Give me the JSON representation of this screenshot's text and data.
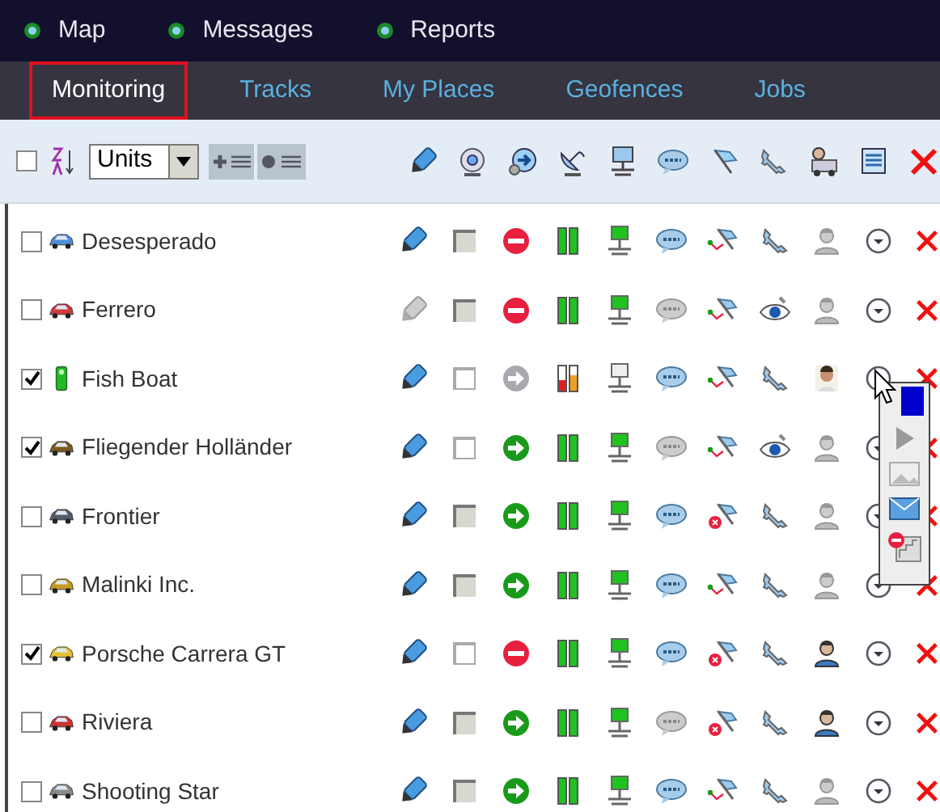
{
  "top_nav": [
    {
      "label": "Map"
    },
    {
      "label": "Messages"
    },
    {
      "label": "Reports"
    }
  ],
  "tabs": [
    {
      "label": "Monitoring",
      "selected": true
    },
    {
      "label": "Tracks",
      "selected": false
    },
    {
      "label": "My Places",
      "selected": false
    },
    {
      "label": "Geofences",
      "selected": false
    },
    {
      "label": "Jobs",
      "selected": false
    }
  ],
  "toolbar": {
    "select_all": false,
    "group_by": "Units"
  },
  "units": [
    {
      "name": "Desesperado",
      "checked": false,
      "kind": "car",
      "color": "#4f8fd8",
      "editable": true,
      "disabled": true,
      "stopped": true,
      "moving": false,
      "signal_low": false,
      "online": true,
      "sms": true,
      "route_error": false,
      "watched": false,
      "driver_assigned": false,
      "driver_photo": false
    },
    {
      "name": "Ferrero",
      "checked": false,
      "kind": "car",
      "color": "#d33a3a",
      "editable": false,
      "disabled": true,
      "stopped": true,
      "moving": false,
      "signal_low": false,
      "online": true,
      "sms": false,
      "route_error": false,
      "watched": true,
      "driver_assigned": false,
      "driver_photo": false
    },
    {
      "name": "Fish Boat",
      "checked": true,
      "kind": "traffic-light",
      "color": "#22bb22",
      "editable": true,
      "disabled": false,
      "stopped": false,
      "moving": false,
      "signal_low": true,
      "online": false,
      "sms": true,
      "route_error": false,
      "watched": false,
      "driver_assigned": true,
      "driver_photo": true
    },
    {
      "name": "Fliegender Holländer",
      "checked": true,
      "kind": "car",
      "color": "#7a5a20",
      "editable": true,
      "disabled": false,
      "stopped": false,
      "moving": true,
      "signal_low": false,
      "online": true,
      "sms": false,
      "route_error": false,
      "watched": true,
      "driver_assigned": false,
      "driver_photo": false
    },
    {
      "name": "Frontier",
      "checked": false,
      "kind": "car",
      "color": "#555a6a",
      "editable": true,
      "disabled": true,
      "stopped": false,
      "moving": true,
      "signal_low": false,
      "online": true,
      "sms": true,
      "route_error": true,
      "watched": false,
      "driver_assigned": false,
      "driver_photo": false
    },
    {
      "name": "Malinki Inc.",
      "checked": false,
      "kind": "car",
      "color": "#c89a20",
      "editable": true,
      "disabled": true,
      "stopped": false,
      "moving": true,
      "signal_low": false,
      "online": true,
      "sms": true,
      "route_error": false,
      "watched": false,
      "driver_assigned": false,
      "driver_photo": false
    },
    {
      "name": "Porsche Carrera GT",
      "checked": true,
      "kind": "car",
      "color": "#e6c030",
      "editable": true,
      "disabled": false,
      "stopped": true,
      "moving": false,
      "signal_low": false,
      "online": true,
      "sms": true,
      "route_error": true,
      "watched": false,
      "driver_assigned": true,
      "driver_photo": false
    },
    {
      "name": "Riviera",
      "checked": false,
      "kind": "car",
      "color": "#cc3333",
      "editable": true,
      "disabled": true,
      "stopped": false,
      "moving": true,
      "signal_low": false,
      "online": true,
      "sms": false,
      "route_error": true,
      "watched": false,
      "driver_assigned": true,
      "driver_photo": false
    },
    {
      "name": "Shooting Star",
      "checked": false,
      "kind": "car",
      "color": "#8a8a8a",
      "editable": true,
      "disabled": true,
      "stopped": false,
      "moving": true,
      "signal_low": false,
      "online": true,
      "sms": true,
      "route_error": false,
      "watched": false,
      "driver_assigned": false,
      "driver_photo": false
    }
  ]
}
